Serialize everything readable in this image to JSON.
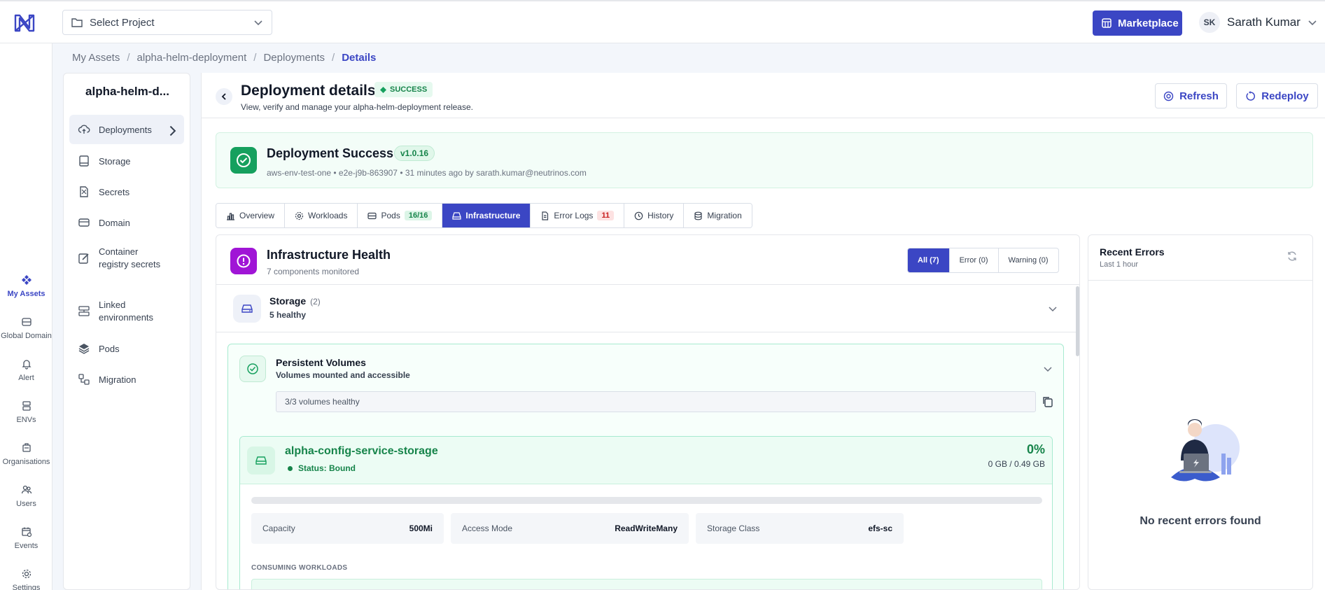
{
  "header": {
    "project_select": "Select Project",
    "marketplace_label": "Marketplace",
    "user_initials": "SK",
    "user_name": "Sarath Kumar"
  },
  "rail": {
    "items": [
      {
        "label": "My Assets",
        "icon": "cubes-icon",
        "active": true
      },
      {
        "label": "Global Domain",
        "icon": "globe-server-icon"
      },
      {
        "label": "Alert",
        "icon": "bell-icon"
      },
      {
        "label": "ENVs",
        "icon": "server-icon"
      },
      {
        "label": "Organisations",
        "icon": "building-icon"
      },
      {
        "label": "Users",
        "icon": "users-icon"
      },
      {
        "label": "Events",
        "icon": "calendar-icon"
      },
      {
        "label": "Settings",
        "icon": "gear-icon"
      }
    ]
  },
  "breadcrumb": [
    "My Assets",
    "alpha-helm-deployment",
    "Deployments",
    "Details"
  ],
  "sidebar": {
    "title": "alpha-helm-d...",
    "items": [
      {
        "label": "Deployments",
        "icon": "cloud-upload-icon",
        "active": true
      },
      {
        "label": "Storage",
        "icon": "storage-icon"
      },
      {
        "label": "Secrets",
        "icon": "secret-file-icon"
      },
      {
        "label": "Domain",
        "icon": "domain-icon"
      },
      {
        "label": "Container registry secrets",
        "icon": "edit-icon"
      },
      {
        "label": "Linked environments",
        "icon": "linked-env-icon"
      },
      {
        "label": "Pods",
        "icon": "layers-icon"
      },
      {
        "label": "Migration",
        "icon": "migration-icon"
      }
    ]
  },
  "main": {
    "title": "Deployment details",
    "status_badge": "SUCCESS",
    "subtitle": "View, verify and manage your alpha-helm-deployment release.",
    "refresh_label": "Refresh",
    "redeploy_label": "Redeploy",
    "success_card": {
      "title": "Deployment Success",
      "version": "v1.0.16",
      "meta": "aws-env-test-one • e2e-j9b-863907 • 31 minutes ago by sarath.kumar@neutrinos.com"
    },
    "tabs": [
      {
        "label": "Overview",
        "icon": "chart-icon"
      },
      {
        "label": "Workloads",
        "icon": "gear-icon"
      },
      {
        "label": "Pods",
        "icon": "pod-icon",
        "count": "16/16"
      },
      {
        "label": "Infrastructure",
        "icon": "hdd-icon",
        "active": true
      },
      {
        "label": "Error Logs",
        "icon": "file-icon",
        "count": "11"
      },
      {
        "label": "History",
        "icon": "clock-icon"
      },
      {
        "label": "Migration",
        "icon": "database-icon"
      }
    ]
  },
  "infra": {
    "title": "Infrastructure Health",
    "subtitle": "7 components monitored",
    "filters": [
      "All (7)",
      "Error (0)",
      "Warning (0)"
    ],
    "storage": {
      "title": "Storage",
      "count": "(2)",
      "sub": "5 healthy"
    },
    "pv": {
      "title": "Persistent Volumes",
      "sub": "Volumes mounted and accessible",
      "summary": "3/3 volumes healthy",
      "volume": {
        "name": "alpha-config-service-storage",
        "status": "Status: Bound",
        "percent": "0%",
        "usage_fraction": 0,
        "usage": "0 GB / 0.49 GB",
        "props": [
          {
            "label": "Capacity",
            "value": "500Mi"
          },
          {
            "label": "Access Mode",
            "value": "ReadWriteMany"
          },
          {
            "label": "Storage Class",
            "value": "efs-sc"
          }
        ],
        "consuming_label": "CONSUMING WORKLOADS"
      }
    }
  },
  "errors": {
    "title": "Recent Errors",
    "sub": "Last 1 hour",
    "empty": "No recent errors found"
  },
  "colors": {
    "accent": "#3b46c4",
    "success": "#16a05e",
    "infra_icon": "#a015d6"
  }
}
